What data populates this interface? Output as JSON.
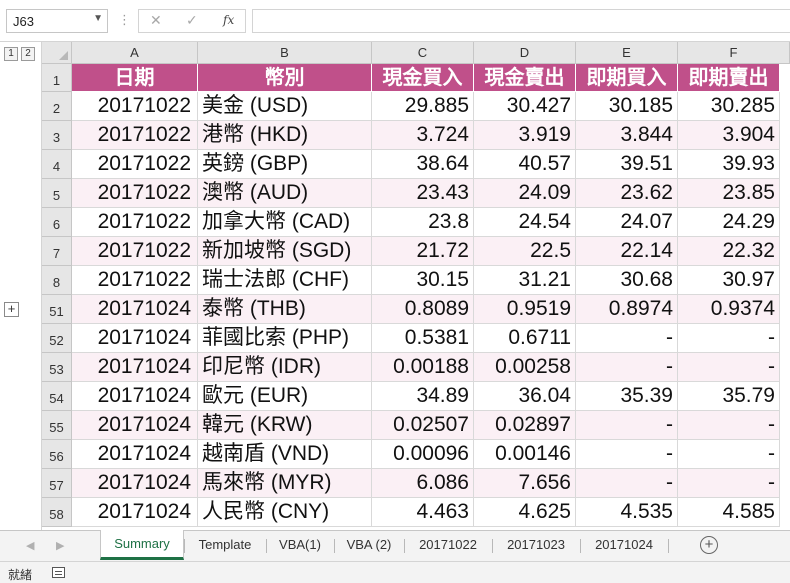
{
  "namebox": {
    "value": "J63"
  },
  "formula_bar": {
    "separator": "⋮",
    "cancel_glyph": "✕",
    "enter_glyph": "✓",
    "fx_label": "fx",
    "content": ""
  },
  "outline": {
    "level1": "1",
    "level2": "2",
    "expand": "+"
  },
  "columns": [
    "A",
    "B",
    "C",
    "D",
    "E",
    "F"
  ],
  "headers": [
    "日期",
    "幣別",
    "現金買入",
    "現金賣出",
    "即期買入",
    "即期賣出"
  ],
  "rows": [
    {
      "row": "2",
      "date": "20171022",
      "currency": "美金 (USD)",
      "cash_buy": "29.885",
      "cash_sell": "30.427",
      "spot_buy": "30.185",
      "spot_sell": "30.285"
    },
    {
      "row": "3",
      "date": "20171022",
      "currency": "港幣 (HKD)",
      "cash_buy": "3.724",
      "cash_sell": "3.919",
      "spot_buy": "3.844",
      "spot_sell": "3.904"
    },
    {
      "row": "4",
      "date": "20171022",
      "currency": "英鎊 (GBP)",
      "cash_buy": "38.64",
      "cash_sell": "40.57",
      "spot_buy": "39.51",
      "spot_sell": "39.93"
    },
    {
      "row": "5",
      "date": "20171022",
      "currency": "澳幣 (AUD)",
      "cash_buy": "23.43",
      "cash_sell": "24.09",
      "spot_buy": "23.62",
      "spot_sell": "23.85"
    },
    {
      "row": "6",
      "date": "20171022",
      "currency": "加拿大幣 (CAD)",
      "cash_buy": "23.8",
      "cash_sell": "24.54",
      "spot_buy": "24.07",
      "spot_sell": "24.29"
    },
    {
      "row": "7",
      "date": "20171022",
      "currency": "新加坡幣 (SGD)",
      "cash_buy": "21.72",
      "cash_sell": "22.5",
      "spot_buy": "22.14",
      "spot_sell": "22.32"
    },
    {
      "row": "8",
      "date": "20171022",
      "currency": "瑞士法郎 (CHF)",
      "cash_buy": "30.15",
      "cash_sell": "31.21",
      "spot_buy": "30.68",
      "spot_sell": "30.97"
    },
    {
      "row": "51",
      "date": "20171024",
      "currency": "泰幣 (THB)",
      "cash_buy": "0.8089",
      "cash_sell": "0.9519",
      "spot_buy": "0.8974",
      "spot_sell": "0.9374"
    },
    {
      "row": "52",
      "date": "20171024",
      "currency": "菲國比索 (PHP)",
      "cash_buy": "0.5381",
      "cash_sell": "0.6711",
      "spot_buy": "-",
      "spot_sell": "-"
    },
    {
      "row": "53",
      "date": "20171024",
      "currency": "印尼幣 (IDR)",
      "cash_buy": "0.00188",
      "cash_sell": "0.00258",
      "spot_buy": "-",
      "spot_sell": "-"
    },
    {
      "row": "54",
      "date": "20171024",
      "currency": "歐元 (EUR)",
      "cash_buy": "34.89",
      "cash_sell": "36.04",
      "spot_buy": "35.39",
      "spot_sell": "35.79"
    },
    {
      "row": "55",
      "date": "20171024",
      "currency": "韓元 (KRW)",
      "cash_buy": "0.02507",
      "cash_sell": "0.02897",
      "spot_buy": "-",
      "spot_sell": "-"
    },
    {
      "row": "56",
      "date": "20171024",
      "currency": "越南盾 (VND)",
      "cash_buy": "0.00096",
      "cash_sell": "0.00146",
      "spot_buy": "-",
      "spot_sell": "-"
    },
    {
      "row": "57",
      "date": "20171024",
      "currency": "馬來幣 (MYR)",
      "cash_buy": "6.086",
      "cash_sell": "7.656",
      "spot_buy": "-",
      "spot_sell": "-"
    },
    {
      "row": "58",
      "date": "20171024",
      "currency": "人民幣 (CNY)",
      "cash_buy": "4.463",
      "cash_sell": "4.625",
      "spot_buy": "4.535",
      "spot_sell": "4.585"
    }
  ],
  "header_row_label": "1",
  "sheet_tabs": [
    "Summary",
    "Template",
    "VBA(1)",
    "VBA (2)",
    "20171022",
    "20171023",
    "20171024"
  ],
  "active_tab": "Summary",
  "add_sheet_glyph": "+",
  "status": {
    "text": "就緒"
  },
  "colors": {
    "header_fill": "#c0508a",
    "band_fill": "#fbf0f5",
    "active_tab": "#1e7145"
  }
}
